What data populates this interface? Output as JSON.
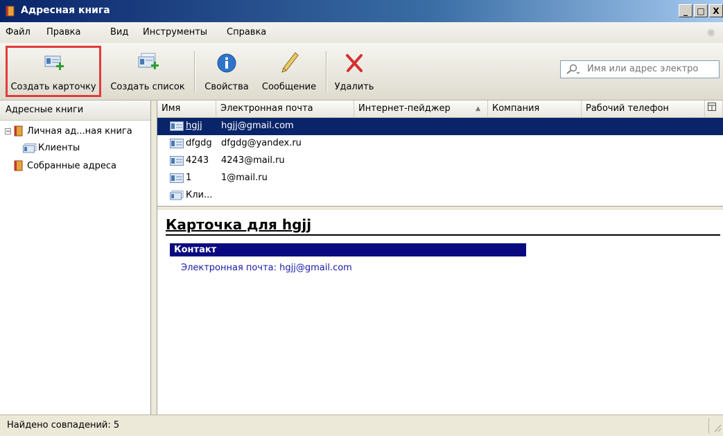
{
  "window": {
    "title": "Адресная книга",
    "buttons": [
      "_",
      "□",
      "X"
    ]
  },
  "menu": [
    "Файл",
    "Правка",
    "Вид",
    "Инструменты",
    "Справка"
  ],
  "toolbar": {
    "new_card": "Создать карточку",
    "new_list": "Создать список",
    "properties": "Свойства",
    "message": "Сообщение",
    "delete": "Удалить"
  },
  "search": {
    "placeholder": "Имя или адрес электро"
  },
  "left": {
    "header": "Адресные книги",
    "tree": [
      {
        "label": "Личная ад...ная книга",
        "expander": "−"
      },
      {
        "label": "Клиенты"
      },
      {
        "label": "Собранные адреса"
      }
    ]
  },
  "columns": [
    "Имя",
    "Электронная почта",
    "Интернет-пейджер",
    "Компания",
    "Рабочий телефон"
  ],
  "sort_indicator": "▲",
  "rows": [
    {
      "name": "hgjj",
      "email": "hgjj@gmail.com",
      "selected": true,
      "type": "card"
    },
    {
      "name": "dfgdg",
      "email": "dfgdg@yandex.ru",
      "selected": false,
      "type": "card"
    },
    {
      "name": "4243",
      "email": "4243@mail.ru",
      "selected": false,
      "type": "card"
    },
    {
      "name": "1",
      "email": "1@mail.ru",
      "selected": false,
      "type": "card"
    },
    {
      "name": "Кли...",
      "email": "",
      "selected": false,
      "type": "list"
    }
  ],
  "card": {
    "title": "Карточка для hgjj",
    "section": "Контакт",
    "email_line": "Электронная почта: hgjj@gmail.com"
  },
  "status": {
    "text": "Найдено совпадений: 5"
  },
  "colors": {
    "selection": "#0a246a",
    "section_bar": "#0a0a80",
    "highlight": "#e23b3b"
  }
}
